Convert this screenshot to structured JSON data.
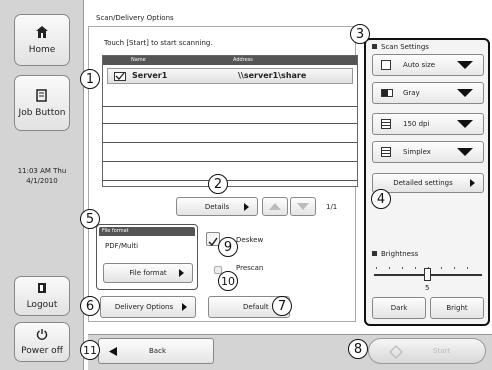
{
  "header": {
    "title": "Scan/Delivery Options"
  },
  "sidebar": {
    "home_label": "Home",
    "job_label": "Job Button",
    "time": "11:03 AM  Thu",
    "date": "4/1/2010",
    "logout_label": "Logout",
    "poweroff_label": "Power off"
  },
  "main": {
    "instruction": "Touch [Start] to start scanning.",
    "col_name": "Name",
    "col_address": "Address",
    "destination": {
      "name": "Server1",
      "address": "\\\\server1\\share"
    },
    "details_label": "Details",
    "page_indicator": "1/1",
    "file_format": {
      "header": "File format",
      "value": "PDF/Multi",
      "button": "File format"
    },
    "deskew_label": "Deskew",
    "prescan_label": "Prescan",
    "delivery_label": "Delivery Options",
    "default_label": "Default",
    "back_label": "Back",
    "start_label": "Start"
  },
  "settings": {
    "title": "Scan Settings",
    "size": "Auto size",
    "color": "Gray",
    "resolution": "150 dpi",
    "sides": "Simplex",
    "detailed_label": "Detailed settings",
    "brightness_title": "Brightness",
    "brightness_value": "5",
    "dark_label": "Dark",
    "bright_label": "Bright"
  },
  "callouts": [
    "1",
    "2",
    "3",
    "4",
    "5",
    "6",
    "7",
    "8",
    "9",
    "10",
    "11"
  ],
  "colors": {
    "sidebar_bg": "#d8d8d8",
    "border": "#111111",
    "start_disabled": "#bbbbbb"
  }
}
